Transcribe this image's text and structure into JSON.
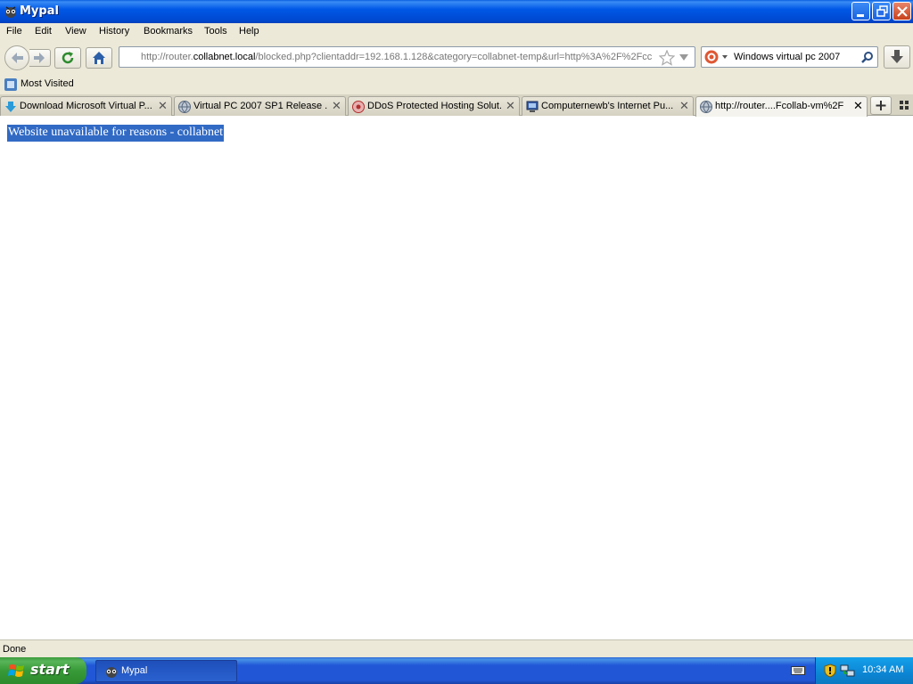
{
  "window": {
    "title": "Mypal"
  },
  "menu": [
    "File",
    "Edit",
    "View",
    "History",
    "Bookmarks",
    "Tools",
    "Help"
  ],
  "toolbar": {
    "url_prefix": "http://router.",
    "url_host": "collabnet.local",
    "url_rest": "/blocked.php?clientaddr=192.168.1.128&category=collabnet-temp&url=http%3A%2F%2Fcc",
    "search_value": "Windows virtual pc 2007"
  },
  "bookmarks": {
    "most_visited": "Most Visited"
  },
  "tabs": [
    {
      "label": "Download Microsoft Virtual P...",
      "icon": "download-favicon"
    },
    {
      "label": "Virtual PC 2007 SP1 Release ...",
      "icon": "globe-favicon"
    },
    {
      "label": "DDoS Protected Hosting Solut...",
      "icon": "ddos-favicon"
    },
    {
      "label": "Computernewb's Internet Pu...",
      "icon": "computer-favicon"
    },
    {
      "label": "http://router....Fcollab-vm%2F",
      "icon": "globe-favicon",
      "active": true
    }
  ],
  "content": {
    "message": "Website unavailable for reasons - collabnet"
  },
  "status": {
    "text": "Done"
  },
  "taskbar": {
    "start_label": "start",
    "task_label": "Mypal",
    "clock": "10:34 AM"
  },
  "colors": {
    "selection": "#316ac5",
    "title_bar": "#0058e6",
    "taskbar": "#2157d7",
    "start": "#379a37"
  }
}
